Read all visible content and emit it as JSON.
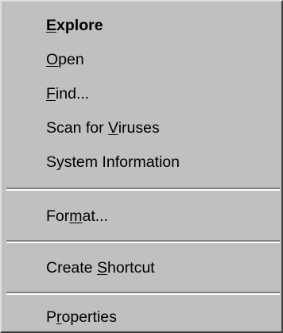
{
  "menu": {
    "items": [
      {
        "pre": "",
        "acc": "E",
        "post": "xplore"
      },
      {
        "pre": "",
        "acc": "O",
        "post": "pen"
      },
      {
        "pre": "",
        "acc": "F",
        "post": "ind..."
      },
      {
        "pre": "Scan for ",
        "acc": "V",
        "post": "iruses"
      },
      {
        "pre": "System Information",
        "acc": "",
        "post": ""
      },
      {
        "pre": "For",
        "acc": "m",
        "post": "at..."
      },
      {
        "pre": "Create ",
        "acc": "S",
        "post": "hortcut"
      },
      {
        "pre": "P",
        "acc": "r",
        "post": "operties"
      }
    ]
  }
}
